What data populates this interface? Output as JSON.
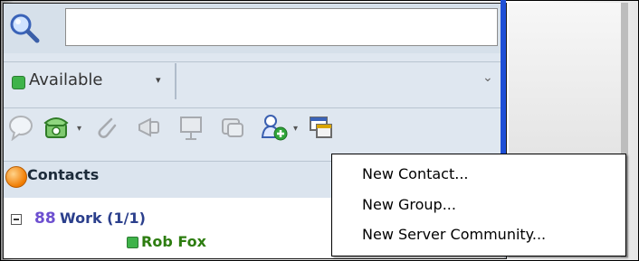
{
  "search": {
    "value": "",
    "placeholder": ""
  },
  "status": {
    "label": "Available",
    "caret": "▾",
    "expand": "⌄",
    "color": "#3fb34a"
  },
  "toolbar": {
    "icons": [
      "chat-bubble-icon",
      "phone-icon",
      "attach-icon",
      "megaphone-icon",
      "presentation-icon",
      "screenshare-icon",
      "add-contact-icon",
      "new-window-icon"
    ]
  },
  "contacts": {
    "title": "Contacts"
  },
  "group": {
    "name": "Work (1/1)"
  },
  "members": [
    {
      "name": "Rob Fox",
      "status": "available"
    }
  ],
  "menu": {
    "items": [
      "New Contact...",
      "New Group...",
      "New Server Community..."
    ]
  },
  "colors": {
    "accent": "#1e4fd6",
    "available": "#3fb34a",
    "member_text": "#2d7d10"
  }
}
